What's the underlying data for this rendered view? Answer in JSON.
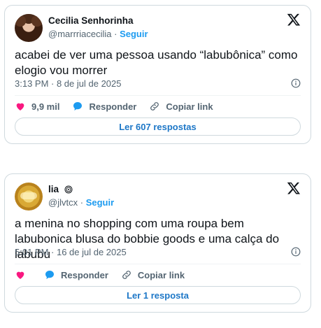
{
  "tweets": [
    {
      "author_name": "Cecilia Senhorinha",
      "handle": "@marrriacecilia",
      "separator": "·",
      "follow_label": "Seguir",
      "text": "acabei de ver uma pessoa usando “labubônica” como elogio vou morrer",
      "timestamp": "3:13 PM · 8 de jul de 2025",
      "likes": "9,9 mil",
      "reply_label": "Responder",
      "copy_label": "Copiar link",
      "replies_button": "Ler 607 respostas"
    },
    {
      "author_name": "lia",
      "handle": "@jlvtcx",
      "separator": "·",
      "follow_label": "Seguir",
      "text": "a menina no shopping com uma roupa bem labubonica blusa do bobbie goods e uma calça do labubu",
      "timestamp": "5:01 PM · 16 de jul de 2025",
      "likes": "",
      "reply_label": "Responder",
      "copy_label": "Copiar link",
      "replies_button": "Ler 1 resposta"
    }
  ],
  "colors": {
    "accent": "#1d9bf0",
    "like": "#f91880",
    "muted": "#536471",
    "text": "#0f1419"
  },
  "icons": [
    "x-logo-icon",
    "info-icon",
    "heart-icon",
    "reply-bubble-icon",
    "link-icon",
    "spiral-icon"
  ]
}
